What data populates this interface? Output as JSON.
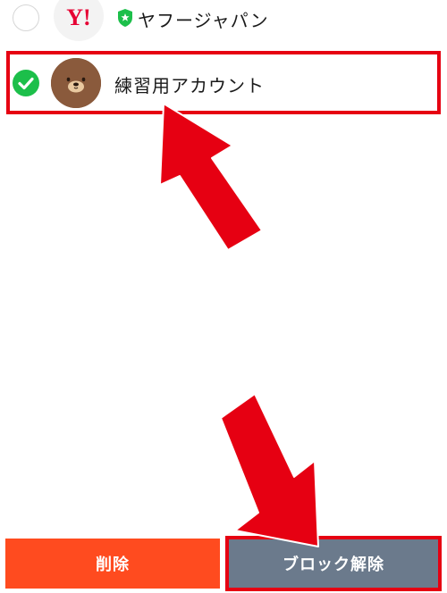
{
  "accounts": [
    {
      "name": "ヤフージャパン",
      "logo_text": "Y!",
      "selected": false,
      "verified": true,
      "avatar_icon": "yahoo-logo"
    },
    {
      "name": "練習用アカウント",
      "selected": true,
      "verified": false,
      "avatar_icon": "brown-bear-avatar"
    }
  ],
  "buttons": {
    "delete_label": "削除",
    "unblock_label": "ブロック解除"
  },
  "colors": {
    "check_green": "#1cbf4a",
    "verified_green": "#1cbf4a",
    "yahoo_red": "#e60033",
    "delete_orange": "#ff4b1f",
    "unblock_gray": "#6b7a8c",
    "annotation_red": "#e60012"
  }
}
